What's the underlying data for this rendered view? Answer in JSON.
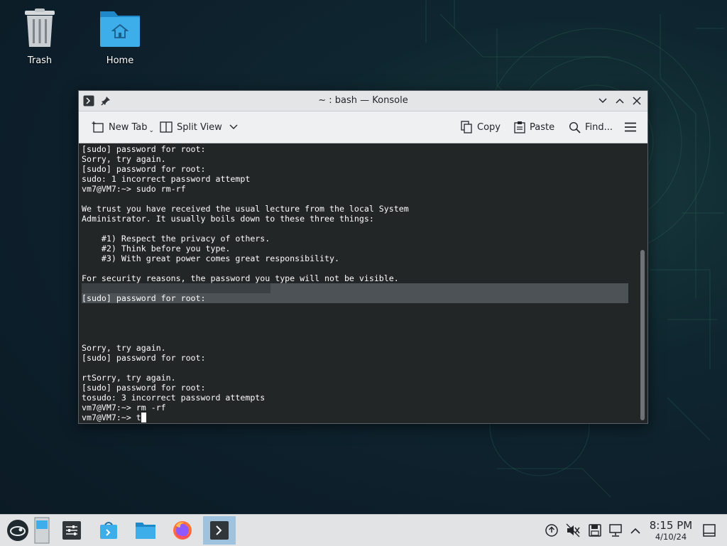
{
  "desktop": {
    "icons": [
      {
        "label": "Trash",
        "icon": "trash-icon"
      },
      {
        "label": "Home",
        "icon": "home-folder-icon"
      }
    ]
  },
  "window": {
    "title": "~ : bash — Konsole",
    "toolbar": {
      "new_tab": "New Tab",
      "split_view": "Split View",
      "copy": "Copy",
      "paste": "Paste",
      "find": "Find..."
    }
  },
  "terminal": {
    "text": "[sudo] password for root:\nSorry, try again.\n[sudo] password for root:\nsudo: 1 incorrect password attempt\nvm7@VM7:~> sudo rm-rf\n\nWe trust you have received the usual lecture from the local System\nAdministrator. It usually boils down to these three things:\n\n    #1) Respect the privacy of others.\n    #2) Think before you type.\n    #3) With great power comes great responsibility.\n\nFor security reasons, the password you type will not be visible.\n\n[sudo] password for root:\n\n\n\n\nSorry, try again.\n[sudo] password for root:\n\nrtSorry, try again.\n[sudo] password for root:\ntosudo: 3 incorrect password attempts\nvm7@VM7:~> rm -rf\nvm7@VM7:~> t"
  },
  "taskbar": {
    "apps": [
      "application-launcher-icon",
      "desktop-pager-icon",
      "system-settings-icon",
      "discover-store-icon",
      "dolphin-file-manager-icon",
      "firefox-icon",
      "konsole-icon"
    ],
    "clock": {
      "time": "8:15 PM",
      "date": "4/10/24"
    }
  },
  "colors": {
    "terminal_bg": "#232627",
    "terminal_fg": "#fcfcfc",
    "active_task": "#9fc3df"
  }
}
